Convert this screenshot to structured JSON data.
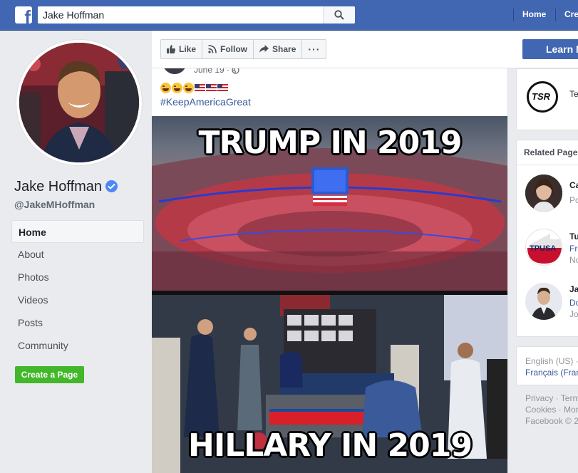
{
  "topbar": {
    "search_value": "Jake Hoffman",
    "nav": [
      "Home",
      "Cre"
    ],
    "brand_color": "#4267b2"
  },
  "profile": {
    "name": "Jake Hoffman",
    "handle": "@JakeMHoffman",
    "verified": true,
    "nav_items": [
      "Home",
      "About",
      "Photos",
      "Videos",
      "Posts",
      "Community"
    ],
    "active_nav": "Home",
    "create_page": "Create a Page"
  },
  "actions": {
    "like": "Like",
    "follow": "Follow",
    "share": "Share",
    "more": "···",
    "learn_more": "Learn M"
  },
  "post": {
    "date": "June 19 ·",
    "emojis": [
      "laughing-emoji",
      "laughing-emoji",
      "laughing-emoji",
      "us-flag",
      "us-flag",
      "us-flag"
    ],
    "hashtag": "#KeepAmericaGreat",
    "meme_top": "TRUMP IN 2019",
    "meme_bottom": "HILLARY IN 2019"
  },
  "right": {
    "tsr_logo_text": "TSR",
    "tsr_name": "Te",
    "related_header": "Related Pages",
    "related": [
      {
        "line1": "Ca",
        "line2": "Po",
        "line3": ""
      },
      {
        "line1": "Tu",
        "line2": "Fr",
        "line3": "No",
        "logo": "TPUSA"
      },
      {
        "line1": "Ja",
        "line2": "Do",
        "line3": "Jo"
      }
    ],
    "languages": [
      "English (US) ·",
      "Français (Fran"
    ],
    "footer": [
      "Privacy · Terms",
      "Cookies · More",
      "Facebook © 2"
    ]
  }
}
